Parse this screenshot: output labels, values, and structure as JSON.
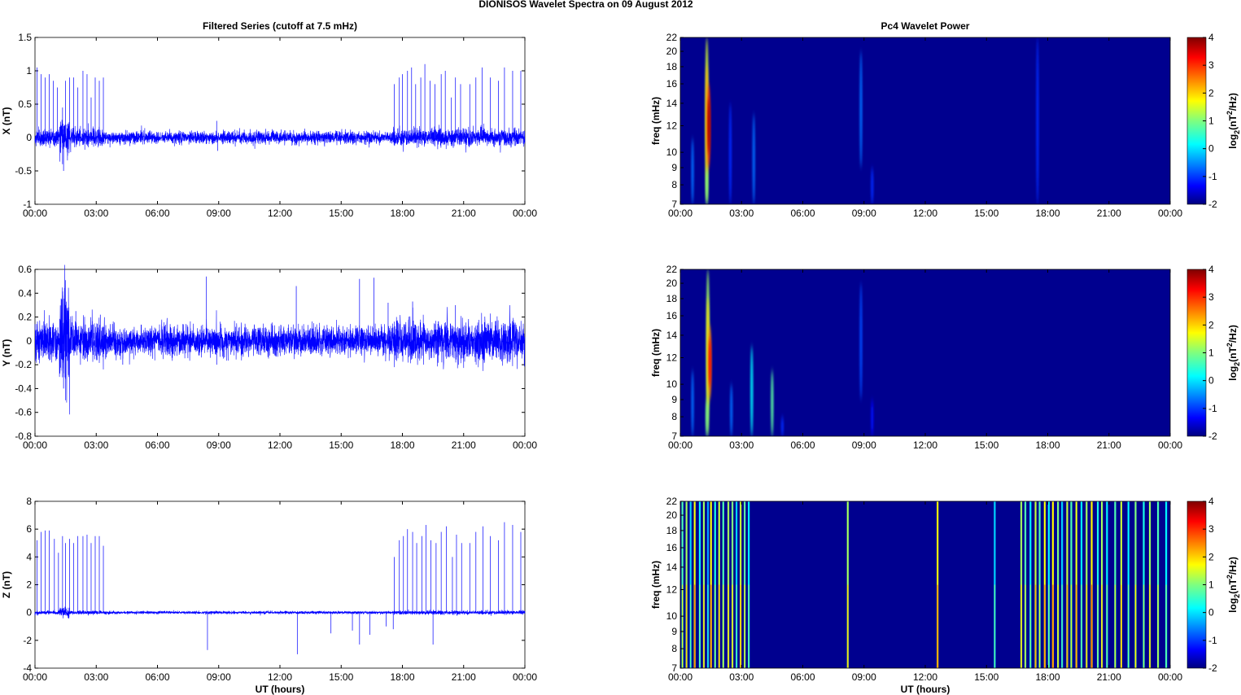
{
  "title": "DIONISOS Wavelet Spectra on 09 August    2012",
  "left_title": "Filtered Series (cutoff at 7.5 mHz)",
  "right_title": "Pc4 Wavelet Power",
  "xlabel": "UT (hours)",
  "x_tick_labels": [
    "00:00",
    "03:00",
    "06:00",
    "09:00",
    "12:00",
    "15:00",
    "18:00",
    "21:00",
    "00:00"
  ],
  "freq_label": "freq (mHz)",
  "freq_ticks": [
    7,
    8,
    9,
    10,
    12,
    14,
    16,
    18,
    20,
    22
  ],
  "colorbar_label": "log2(nT2/Hz)",
  "colorbar_ticks": [
    -2,
    -1,
    0,
    1,
    2,
    3,
    4
  ],
  "chart_data": [
    {
      "type": "line",
      "component": "X",
      "ylabel": "X (nT)",
      "ylim": [
        -1,
        1.5
      ],
      "yticks": [
        -1,
        -0.5,
        0,
        0.5,
        1,
        1.5
      ],
      "xlim": [
        0,
        24
      ],
      "color": "#0000ff",
      "noise_std": 0.045,
      "spikes": [
        [
          0.1,
          1.05
        ],
        [
          0.3,
          0.95
        ],
        [
          0.5,
          0.9
        ],
        [
          0.7,
          0.95
        ],
        [
          0.9,
          0.85
        ],
        [
          1.1,
          0.75
        ],
        [
          1.35,
          0.45
        ],
        [
          1.5,
          0.85
        ],
        [
          1.7,
          0.9
        ],
        [
          1.9,
          0.9
        ],
        [
          2.1,
          0.75
        ],
        [
          2.35,
          1.0
        ],
        [
          2.55,
          0.95
        ],
        [
          2.75,
          0.6
        ],
        [
          2.95,
          0.9
        ],
        [
          3.15,
          0.85
        ],
        [
          3.35,
          0.9
        ],
        [
          8.9,
          0.25
        ],
        [
          17.6,
          0.8
        ],
        [
          17.85,
          0.9
        ],
        [
          18.0,
          0.95
        ],
        [
          18.25,
          1.0
        ],
        [
          18.45,
          1.05
        ],
        [
          18.65,
          0.8
        ],
        [
          18.9,
          0.9
        ],
        [
          19.1,
          1.1
        ],
        [
          19.35,
          0.85
        ],
        [
          19.6,
          0.8
        ],
        [
          19.9,
          0.95
        ],
        [
          20.1,
          1.0
        ],
        [
          20.4,
          0.6
        ],
        [
          20.6,
          0.9
        ],
        [
          20.85,
          0.8
        ],
        [
          21.3,
          0.8
        ],
        [
          21.6,
          0.9
        ],
        [
          21.9,
          1.05
        ],
        [
          22.3,
          0.9
        ],
        [
          22.7,
          0.85
        ],
        [
          23.0,
          1.05
        ],
        [
          23.4,
          1.0
        ],
        [
          23.8,
          1.0
        ]
      ],
      "neg_spikes": [
        [
          1.4,
          -0.5
        ],
        [
          1.35,
          -0.4
        ],
        [
          8.95,
          -0.2
        ]
      ]
    },
    {
      "type": "line",
      "component": "Y",
      "ylabel": "Y (nT)",
      "ylim": [
        -0.8,
        0.6
      ],
      "yticks": [
        -0.8,
        -0.6,
        -0.4,
        -0.2,
        0,
        0.2,
        0.4,
        0.6
      ],
      "xlim": [
        0,
        24
      ],
      "color": "#0000ff",
      "noise_std": 0.06,
      "spikes": [
        [
          1.35,
          0.38
        ],
        [
          1.5,
          0.3
        ],
        [
          2.0,
          0.25
        ],
        [
          3.2,
          0.22
        ],
        [
          8.4,
          0.54
        ],
        [
          12.8,
          0.46
        ],
        [
          15.9,
          0.52
        ],
        [
          16.6,
          0.53
        ],
        [
          17.3,
          0.32
        ],
        [
          18.5,
          0.33
        ],
        [
          20.6,
          0.3
        ]
      ],
      "neg_spikes": [
        [
          1.4,
          -0.4
        ],
        [
          1.5,
          -0.32
        ],
        [
          4.3,
          -0.2
        ],
        [
          8.9,
          -0.2
        ]
      ]
    },
    {
      "type": "line",
      "component": "Z",
      "ylabel": "Z (nT)",
      "ylim": [
        -4,
        8
      ],
      "yticks": [
        -4,
        -2,
        0,
        2,
        4,
        6,
        8
      ],
      "xlim": [
        0,
        24
      ],
      "color": "#0000ff",
      "noise_std": 0.05,
      "spikes": [
        [
          0.1,
          5.2
        ],
        [
          0.3,
          5.8
        ],
        [
          0.5,
          5.9
        ],
        [
          0.7,
          5.9
        ],
        [
          0.95,
          5.3
        ],
        [
          1.15,
          4.3
        ],
        [
          1.35,
          5.5
        ],
        [
          1.5,
          5.0
        ],
        [
          1.7,
          5.3
        ],
        [
          1.9,
          5.0
        ],
        [
          2.1,
          5.5
        ],
        [
          2.35,
          5.5
        ],
        [
          2.55,
          5.6
        ],
        [
          2.75,
          5.0
        ],
        [
          2.95,
          5.5
        ],
        [
          3.15,
          5.5
        ],
        [
          3.35,
          4.8
        ],
        [
          17.6,
          4.0
        ],
        [
          17.85,
          5.2
        ],
        [
          18.05,
          5.5
        ],
        [
          18.25,
          6.0
        ],
        [
          18.5,
          5.8
        ],
        [
          18.7,
          5.0
        ],
        [
          18.95,
          5.5
        ],
        [
          19.15,
          6.3
        ],
        [
          19.4,
          5.2
        ],
        [
          19.65,
          5.0
        ],
        [
          19.9,
          5.8
        ],
        [
          20.15,
          6.2
        ],
        [
          20.45,
          4.0
        ],
        [
          20.65,
          5.6
        ],
        [
          20.9,
          5.0
        ],
        [
          21.3,
          5.0
        ],
        [
          21.6,
          5.8
        ],
        [
          21.95,
          6.2
        ],
        [
          22.3,
          5.5
        ],
        [
          22.7,
          5.2
        ],
        [
          23.0,
          6.5
        ],
        [
          23.4,
          6.3
        ],
        [
          23.8,
          5.8
        ]
      ],
      "neg_spikes": [
        [
          8.45,
          -2.7
        ],
        [
          12.85,
          -3.0
        ],
        [
          14.5,
          -1.5
        ],
        [
          15.55,
          -1.3
        ],
        [
          15.9,
          -2.3
        ],
        [
          16.4,
          -1.6
        ],
        [
          17.2,
          -1.0
        ],
        [
          17.55,
          -1.2
        ],
        [
          19.5,
          -2.3
        ]
      ]
    }
  ],
  "spectra": [
    {
      "component": "X",
      "bursts": [
        [
          0.6,
          7,
          11,
          -0.6,
          0.06
        ],
        [
          1.3,
          7,
          22,
          1.5,
          0.08
        ],
        [
          1.4,
          9,
          16,
          3.0,
          0.07
        ],
        [
          1.3,
          7,
          9,
          1.0,
          0.06
        ],
        [
          2.45,
          7,
          14,
          -1,
          0.04
        ],
        [
          3.6,
          7,
          13,
          -0.6,
          0.04
        ],
        [
          8.85,
          9,
          20,
          -0.6,
          0.06
        ],
        [
          9.4,
          7,
          9,
          -1,
          0.04
        ],
        [
          17.5,
          7,
          22,
          -1,
          0.03
        ]
      ]
    },
    {
      "component": "Y",
      "bursts": [
        [
          0.6,
          7,
          11,
          -0.6,
          0.05
        ],
        [
          1.35,
          7,
          22,
          1.2,
          0.08
        ],
        [
          1.45,
          9,
          15,
          2.5,
          0.07
        ],
        [
          1.3,
          7,
          9,
          1.0,
          0.06
        ],
        [
          2.5,
          7,
          10,
          -0.6,
          0.05
        ],
        [
          3.5,
          7,
          13,
          0.2,
          0.05
        ],
        [
          4.5,
          7,
          11,
          0.8,
          0.06
        ],
        [
          5.0,
          7,
          8,
          -1,
          0.04
        ],
        [
          8.85,
          9,
          20,
          -0.8,
          0.05
        ],
        [
          9.4,
          7,
          9,
          -1.2,
          0.04
        ]
      ]
    },
    {
      "component": "Z",
      "lines": [
        [
          0.1,
          1.5
        ],
        [
          0.3,
          2.0
        ],
        [
          0.5,
          0.8
        ],
        [
          0.7,
          2.5
        ],
        [
          0.95,
          1.0
        ],
        [
          1.15,
          2.0
        ],
        [
          1.35,
          0.5
        ],
        [
          1.5,
          2.5
        ],
        [
          1.7,
          1.2
        ],
        [
          1.9,
          2.2
        ],
        [
          2.1,
          1.5
        ],
        [
          2.35,
          2.0
        ],
        [
          2.55,
          1.8
        ],
        [
          2.75,
          0.8
        ],
        [
          2.95,
          2.2
        ],
        [
          3.15,
          1.6
        ],
        [
          3.35,
          1.0
        ],
        [
          8.2,
          2.0
        ],
        [
          12.6,
          2.5
        ],
        [
          15.4,
          0.8
        ],
        [
          16.7,
          2.0
        ],
        [
          16.9,
          1.5
        ],
        [
          17.15,
          1.0
        ],
        [
          17.4,
          2.2
        ],
        [
          17.6,
          1.5
        ],
        [
          17.85,
          2.5
        ],
        [
          18.05,
          1.0
        ],
        [
          18.25,
          2.6
        ],
        [
          18.5,
          1.8
        ],
        [
          18.7,
          0.8
        ],
        [
          18.95,
          2.2
        ],
        [
          19.15,
          1.5
        ],
        [
          19.4,
          2.4
        ],
        [
          19.65,
          1.0
        ],
        [
          19.9,
          2.0
        ],
        [
          20.15,
          2.6
        ],
        [
          20.45,
          1.2
        ],
        [
          20.65,
          2.0
        ],
        [
          20.9,
          1.0
        ],
        [
          21.3,
          1.5
        ],
        [
          21.6,
          2.2
        ],
        [
          21.95,
          1.0
        ],
        [
          22.3,
          1.8
        ],
        [
          22.7,
          1.2
        ],
        [
          23.0,
          2.0
        ],
        [
          23.4,
          1.5
        ],
        [
          23.8,
          1.0
        ]
      ]
    }
  ]
}
